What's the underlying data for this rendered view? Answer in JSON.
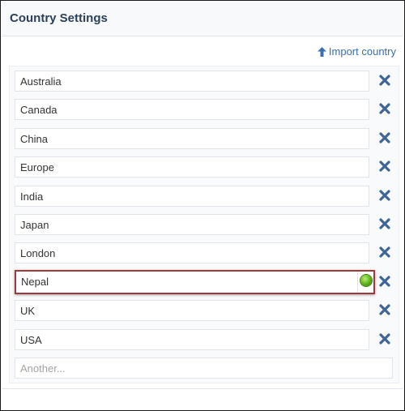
{
  "panel": {
    "title": "Country Settings"
  },
  "toolbar": {
    "import_label": "Import country",
    "import_icon": "arrow-up-icon"
  },
  "countries": [
    {
      "label": "Australia"
    },
    {
      "label": "Canada"
    },
    {
      "label": "China"
    },
    {
      "label": "Europe"
    },
    {
      "label": "India"
    },
    {
      "label": "Japan"
    },
    {
      "label": "London"
    },
    {
      "label": "Nepal",
      "active": true
    },
    {
      "label": "UK"
    },
    {
      "label": "USA"
    }
  ],
  "new_entry": {
    "placeholder": "Another..."
  },
  "colors": {
    "title": "#2b3e5a",
    "link": "#3a6fb0",
    "remove_icon": "#3d6696",
    "active_border": "#a0393d",
    "ok_icon": "#5cae1d"
  },
  "icons": {
    "remove": "close-x-icon",
    "confirm": "green-dot-icon"
  }
}
